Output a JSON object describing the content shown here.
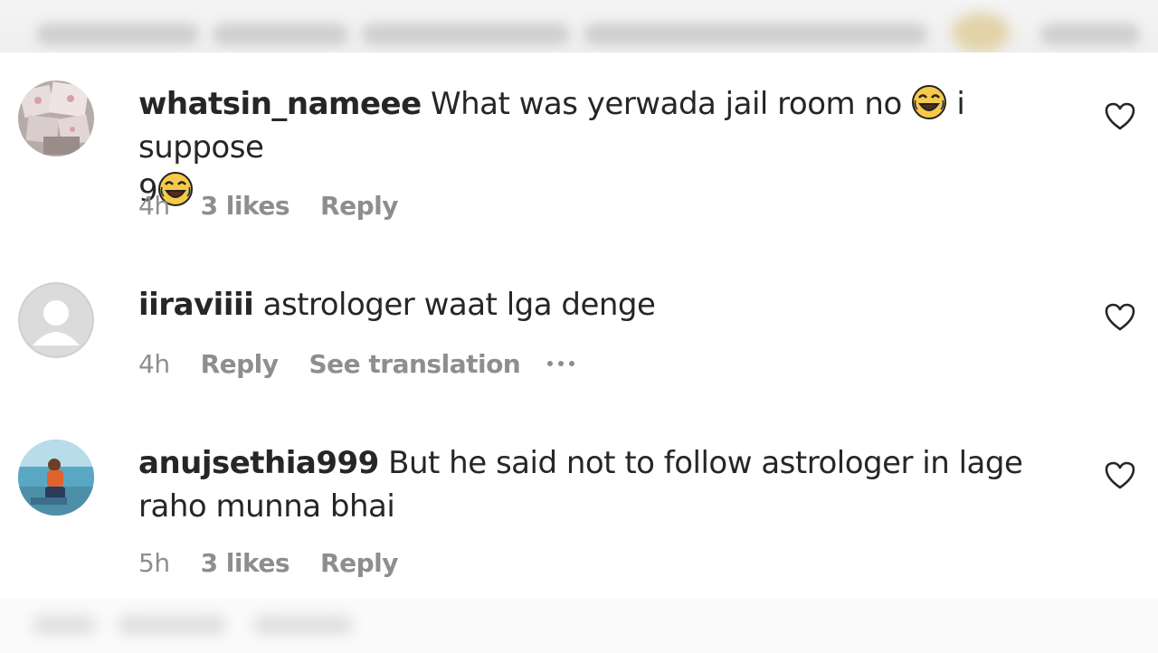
{
  "comments": [
    {
      "username": "whatsin_nameee",
      "text_before": "What was yerwada jail room no",
      "text_middle": "i suppose",
      "text_end": "9",
      "time": "4h",
      "likes": "3 likes",
      "reply": "Reply"
    },
    {
      "username": "iiraviiii",
      "text": "astrologer waat lga denge",
      "time": "4h",
      "reply": "Reply",
      "translation": "See translation"
    },
    {
      "username": "anujsethia999",
      "text": "But he said not to follow astrologer in lage raho munna bhai",
      "time": "5h",
      "likes": "3 likes",
      "reply": "Reply"
    }
  ],
  "icons": {
    "like": "heart-outline-icon",
    "emoji": "face-with-tears-of-joy",
    "more": "more-options-icon"
  },
  "colors": {
    "primary_text": "#262626",
    "secondary_text": "#8e8e8e",
    "background": "#ffffff"
  }
}
